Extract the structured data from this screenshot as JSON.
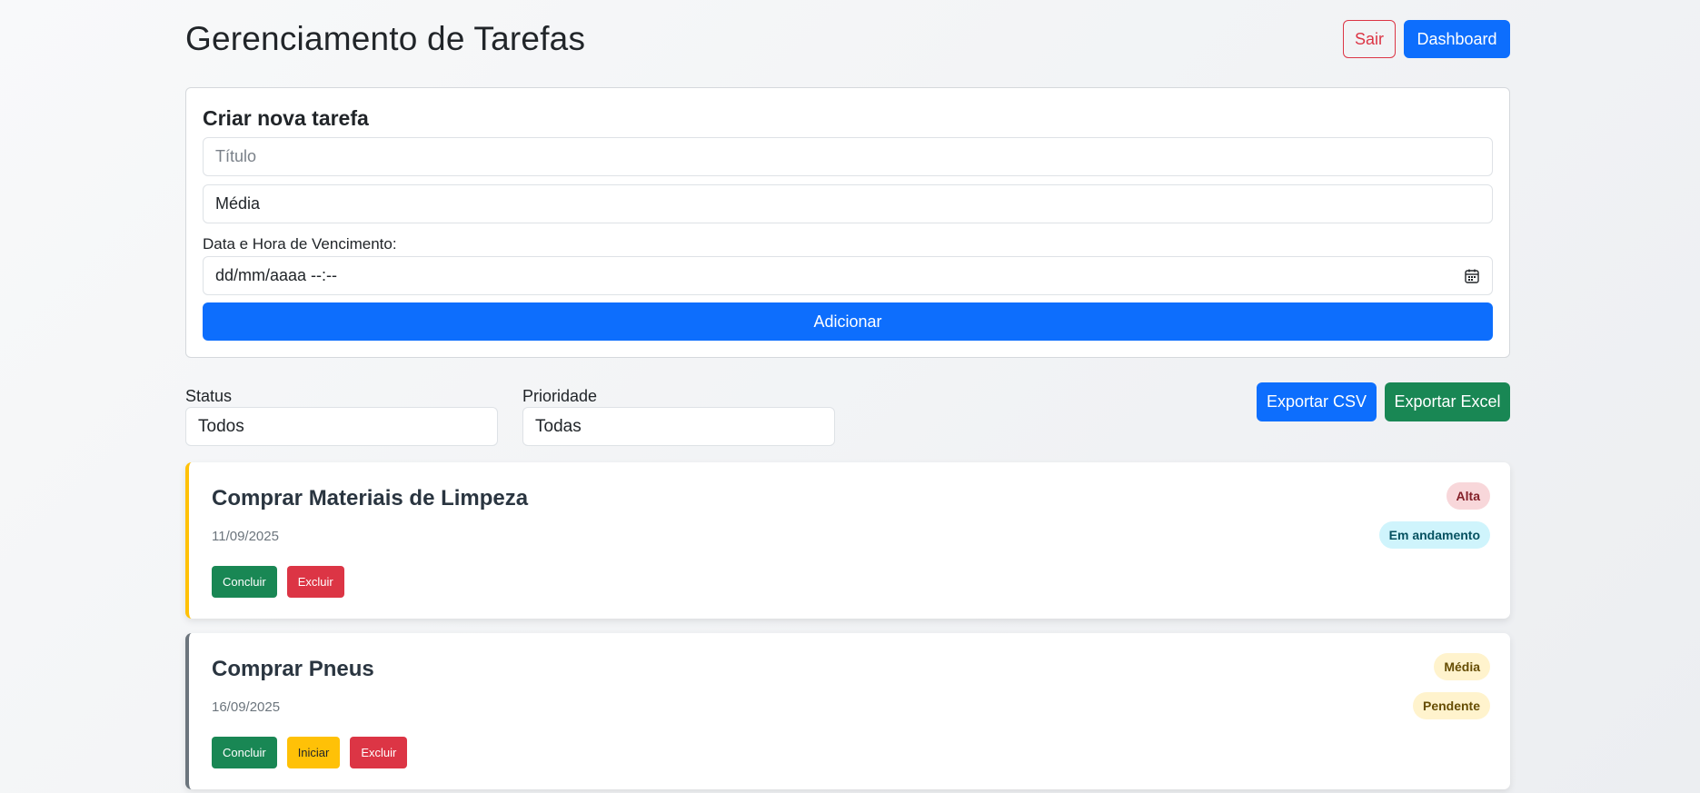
{
  "header": {
    "title": "Gerenciamento de Tarefas",
    "logout_label": "Sair",
    "dashboard_label": "Dashboard"
  },
  "create_form": {
    "heading": "Criar nova tarefa",
    "title_placeholder": "Título",
    "priority_value": "Média",
    "due_label": "Data e Hora de Vencimento:",
    "due_placeholder": "dd/mm/aaaa --:--",
    "add_label": "Adicionar"
  },
  "filters": {
    "status_label": "Status",
    "status_value": "Todos",
    "priority_label": "Prioridade",
    "priority_value": "Todas"
  },
  "export": {
    "csv_label": "Exportar CSV",
    "excel_label": "Exportar Excel"
  },
  "tasks": [
    {
      "title": "Comprar Materiais de Limpeza",
      "date": "11/09/2025",
      "priority": "Alta",
      "status": "Em andamento",
      "accent_color": "#ffc107",
      "actions": {
        "complete": "Concluir",
        "delete": "Excluir"
      }
    },
    {
      "title": "Comprar Pneus",
      "date": "16/09/2025",
      "priority": "Média",
      "status": "Pendente",
      "accent_color": "#6c757d",
      "actions": {
        "complete": "Concluir",
        "start": "Iniciar",
        "delete": "Excluir"
      }
    }
  ],
  "colors": {
    "primary": "#0d6efd",
    "success": "#198754",
    "danger": "#dc3545",
    "warning": "#ffc107"
  },
  "icons": {
    "date_picker": "calendar-icon"
  }
}
